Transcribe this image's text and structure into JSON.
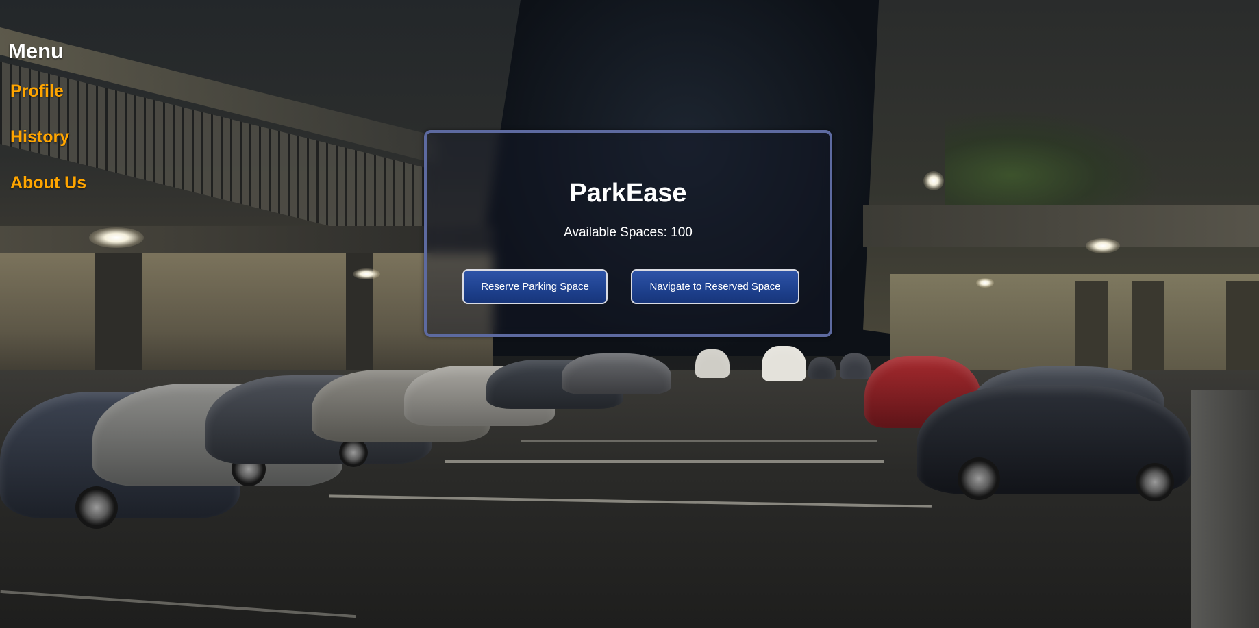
{
  "sidebar": {
    "title": "Menu",
    "items": [
      {
        "label": "Profile"
      },
      {
        "label": "History"
      },
      {
        "label": "About Us"
      }
    ]
  },
  "card": {
    "title": "ParkEase",
    "available_spaces": "Available Spaces: 100",
    "buttons": {
      "reserve": "Reserve Parking Space",
      "navigate": "Navigate to Reserved Space"
    }
  },
  "colors": {
    "menu_link": "#ffa500",
    "card_border": "#5d6aa0",
    "button_fill": "#1f4290",
    "text": "#ffffff"
  }
}
